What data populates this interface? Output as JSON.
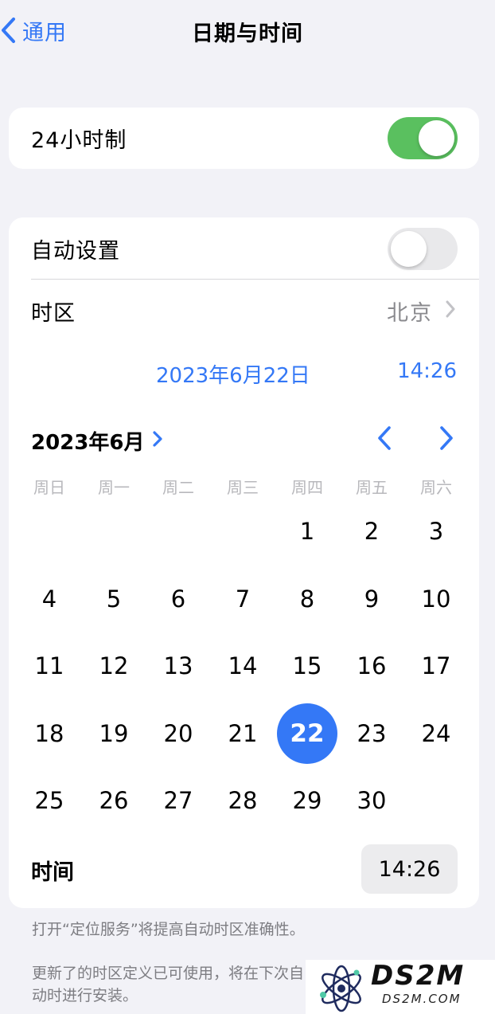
{
  "nav": {
    "back_label": "通用",
    "title": "日期与时间"
  },
  "settings": {
    "hour24_label": "24小时制",
    "hour24_on": true,
    "auto_label": "自动设置",
    "auto_on": false,
    "timezone_label": "时区",
    "timezone_value": "北京"
  },
  "datetime": {
    "date": "2023年6月22日",
    "time": "14:26"
  },
  "calendar": {
    "month_label": "2023年6月",
    "weekdays": [
      "周日",
      "周一",
      "周二",
      "周三",
      "周四",
      "周五",
      "周六"
    ],
    "days": [
      "1",
      "2",
      "3",
      "4",
      "5",
      "6",
      "7",
      "8",
      "9",
      "10",
      "11",
      "12",
      "13",
      "14",
      "15",
      "16",
      "17",
      "18",
      "19",
      "20",
      "21",
      "22",
      "23",
      "24",
      "25",
      "26",
      "27",
      "28",
      "29",
      "30"
    ],
    "selected_day": "22"
  },
  "time_row": {
    "label": "时间",
    "value": "14:26"
  },
  "footnotes": {
    "location": "打开“定位服务”将提高自动时区准确性。",
    "update": "更新了的时区定义已可使用，将在下次自动时进行安装。"
  },
  "watermark": {
    "title": "DS2M",
    "subtitle": "DS2M.COM"
  },
  "colors": {
    "accent": "#3478f6",
    "toggle_on": "#5ac05f",
    "toggle_off": "#e9e9eb",
    "background": "#f2f2f7"
  },
  "icons": {
    "back": "chevron-left-icon",
    "timezone": "chevron-right-icon",
    "month": "chevron-right-icon",
    "prev": "chevron-left-icon",
    "next": "chevron-right-icon"
  }
}
